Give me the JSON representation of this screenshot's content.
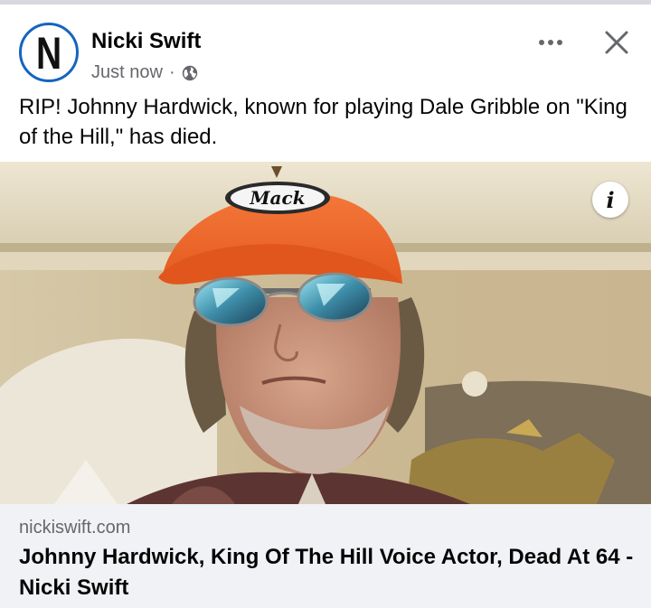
{
  "post": {
    "author": "Nicki Swift",
    "avatar_letter": "N",
    "timestamp": "Just now",
    "separator": "·",
    "privacy_icon": "globe-icon",
    "more_icon": "more-horizontal-icon",
    "close_icon": "close-icon",
    "text": "RIP! Johnny Hardwick, known for playing Dale Gribble on \"King of the Hill,\" has died."
  },
  "media": {
    "hat_logo_text": "Mack",
    "info_label": "i"
  },
  "link_preview": {
    "domain": "nickiswift.com",
    "title": "Johnny Hardwick, King Of The Hill Voice Actor, Dead At 64 - Nicki Swift"
  },
  "colors": {
    "avatar_ring": "#1565c0",
    "link_box_bg": "#f0f2f5",
    "secondary_text": "#65676b",
    "hat_orange": "#f06a2a"
  }
}
